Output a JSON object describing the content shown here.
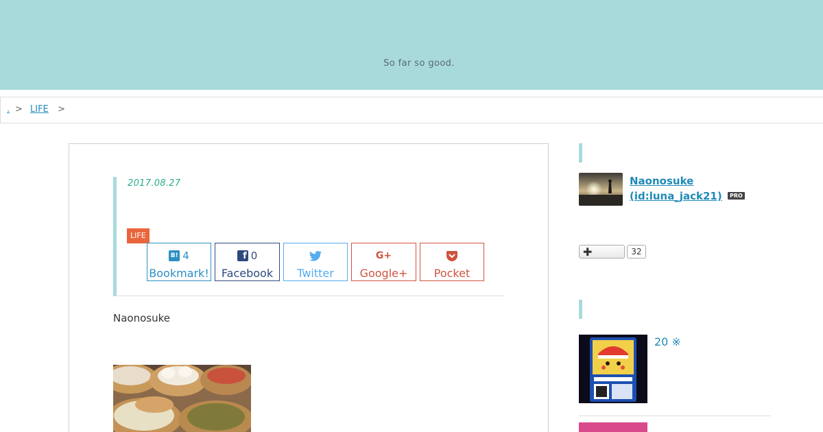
{
  "header": {
    "tagline": "So far so good."
  },
  "breadcrumb": {
    "home_label": ".",
    "category_label": "LIFE",
    "separator": ">"
  },
  "article": {
    "date": "2017.08.27",
    "category": "LIFE",
    "author": "Naonosuke",
    "share": {
      "hatena": {
        "count": "4",
        "label": "Bookmark!"
      },
      "facebook": {
        "count": "0",
        "label": "Facebook"
      },
      "twitter": {
        "label": "Twitter"
      },
      "google": {
        "label": "Google+"
      },
      "pocket": {
        "label": "Pocket"
      }
    }
  },
  "sidebar": {
    "profile": {
      "name": "Naonosuke",
      "id": "(id:luna_jack21)",
      "badge": "PRO"
    },
    "follow": {
      "count": "32"
    },
    "recent_post": {
      "title": "20 ※"
    }
  },
  "colors": {
    "header": "#a8dadb",
    "link": "#1f8ab8",
    "date": "#2bab8c",
    "category": "#e9663c",
    "hatena": "#2b8fc3",
    "facebook": "#2d4a7d",
    "twitter": "#55acee",
    "google": "#d0533f",
    "pocket": "#d0533f"
  },
  "icons": [
    "hatena-b-icon",
    "facebook-icon",
    "twitter-icon",
    "google-plus-icon",
    "pocket-icon",
    "plus-icon"
  ]
}
